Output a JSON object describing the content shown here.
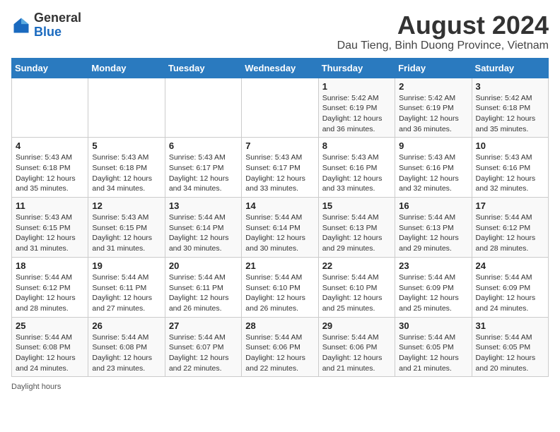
{
  "logo": {
    "text_general": "General",
    "text_blue": "Blue"
  },
  "title": "August 2024",
  "subtitle": "Dau Tieng, Binh Duong Province, Vietnam",
  "days_of_week": [
    "Sunday",
    "Monday",
    "Tuesday",
    "Wednesday",
    "Thursday",
    "Friday",
    "Saturday"
  ],
  "footer": "Daylight hours",
  "weeks": [
    [
      {
        "day": "",
        "info": ""
      },
      {
        "day": "",
        "info": ""
      },
      {
        "day": "",
        "info": ""
      },
      {
        "day": "",
        "info": ""
      },
      {
        "day": "1",
        "info": "Sunrise: 5:42 AM\nSunset: 6:19 PM\nDaylight: 12 hours and 36 minutes."
      },
      {
        "day": "2",
        "info": "Sunrise: 5:42 AM\nSunset: 6:19 PM\nDaylight: 12 hours and 36 minutes."
      },
      {
        "day": "3",
        "info": "Sunrise: 5:42 AM\nSunset: 6:18 PM\nDaylight: 12 hours and 35 minutes."
      }
    ],
    [
      {
        "day": "4",
        "info": "Sunrise: 5:43 AM\nSunset: 6:18 PM\nDaylight: 12 hours and 35 minutes."
      },
      {
        "day": "5",
        "info": "Sunrise: 5:43 AM\nSunset: 6:18 PM\nDaylight: 12 hours and 34 minutes."
      },
      {
        "day": "6",
        "info": "Sunrise: 5:43 AM\nSunset: 6:17 PM\nDaylight: 12 hours and 34 minutes."
      },
      {
        "day": "7",
        "info": "Sunrise: 5:43 AM\nSunset: 6:17 PM\nDaylight: 12 hours and 33 minutes."
      },
      {
        "day": "8",
        "info": "Sunrise: 5:43 AM\nSunset: 6:16 PM\nDaylight: 12 hours and 33 minutes."
      },
      {
        "day": "9",
        "info": "Sunrise: 5:43 AM\nSunset: 6:16 PM\nDaylight: 12 hours and 32 minutes."
      },
      {
        "day": "10",
        "info": "Sunrise: 5:43 AM\nSunset: 6:16 PM\nDaylight: 12 hours and 32 minutes."
      }
    ],
    [
      {
        "day": "11",
        "info": "Sunrise: 5:43 AM\nSunset: 6:15 PM\nDaylight: 12 hours and 31 minutes."
      },
      {
        "day": "12",
        "info": "Sunrise: 5:43 AM\nSunset: 6:15 PM\nDaylight: 12 hours and 31 minutes."
      },
      {
        "day": "13",
        "info": "Sunrise: 5:44 AM\nSunset: 6:14 PM\nDaylight: 12 hours and 30 minutes."
      },
      {
        "day": "14",
        "info": "Sunrise: 5:44 AM\nSunset: 6:14 PM\nDaylight: 12 hours and 30 minutes."
      },
      {
        "day": "15",
        "info": "Sunrise: 5:44 AM\nSunset: 6:13 PM\nDaylight: 12 hours and 29 minutes."
      },
      {
        "day": "16",
        "info": "Sunrise: 5:44 AM\nSunset: 6:13 PM\nDaylight: 12 hours and 29 minutes."
      },
      {
        "day": "17",
        "info": "Sunrise: 5:44 AM\nSunset: 6:12 PM\nDaylight: 12 hours and 28 minutes."
      }
    ],
    [
      {
        "day": "18",
        "info": "Sunrise: 5:44 AM\nSunset: 6:12 PM\nDaylight: 12 hours and 28 minutes."
      },
      {
        "day": "19",
        "info": "Sunrise: 5:44 AM\nSunset: 6:11 PM\nDaylight: 12 hours and 27 minutes."
      },
      {
        "day": "20",
        "info": "Sunrise: 5:44 AM\nSunset: 6:11 PM\nDaylight: 12 hours and 26 minutes."
      },
      {
        "day": "21",
        "info": "Sunrise: 5:44 AM\nSunset: 6:10 PM\nDaylight: 12 hours and 26 minutes."
      },
      {
        "day": "22",
        "info": "Sunrise: 5:44 AM\nSunset: 6:10 PM\nDaylight: 12 hours and 25 minutes."
      },
      {
        "day": "23",
        "info": "Sunrise: 5:44 AM\nSunset: 6:09 PM\nDaylight: 12 hours and 25 minutes."
      },
      {
        "day": "24",
        "info": "Sunrise: 5:44 AM\nSunset: 6:09 PM\nDaylight: 12 hours and 24 minutes."
      }
    ],
    [
      {
        "day": "25",
        "info": "Sunrise: 5:44 AM\nSunset: 6:08 PM\nDaylight: 12 hours and 24 minutes."
      },
      {
        "day": "26",
        "info": "Sunrise: 5:44 AM\nSunset: 6:08 PM\nDaylight: 12 hours and 23 minutes."
      },
      {
        "day": "27",
        "info": "Sunrise: 5:44 AM\nSunset: 6:07 PM\nDaylight: 12 hours and 22 minutes."
      },
      {
        "day": "28",
        "info": "Sunrise: 5:44 AM\nSunset: 6:06 PM\nDaylight: 12 hours and 22 minutes."
      },
      {
        "day": "29",
        "info": "Sunrise: 5:44 AM\nSunset: 6:06 PM\nDaylight: 12 hours and 21 minutes."
      },
      {
        "day": "30",
        "info": "Sunrise: 5:44 AM\nSunset: 6:05 PM\nDaylight: 12 hours and 21 minutes."
      },
      {
        "day": "31",
        "info": "Sunrise: 5:44 AM\nSunset: 6:05 PM\nDaylight: 12 hours and 20 minutes."
      }
    ]
  ]
}
